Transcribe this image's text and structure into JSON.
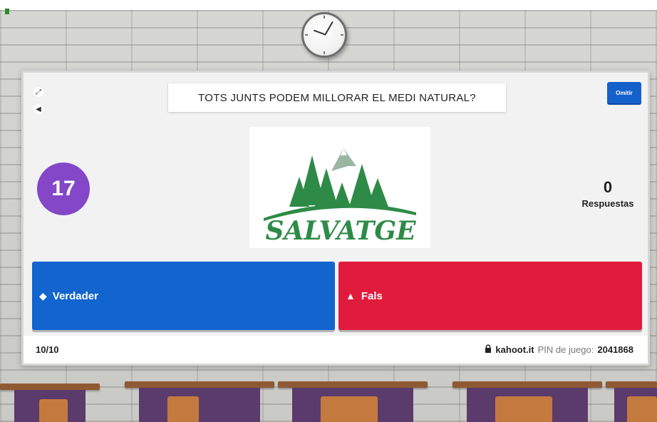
{
  "question": {
    "text": "TOTS JUNTS PODEM MILLORAR EL MEDI NATURAL?"
  },
  "controls": {
    "skip_label": "Omitir",
    "icons": [
      "expand-icon",
      "sound-icon"
    ]
  },
  "timer": {
    "seconds": "17",
    "color": "#8447c7"
  },
  "image": {
    "logo_text": "SALVATGE",
    "logo_color": "#2e8b47"
  },
  "answers_count": {
    "value": "0",
    "label": "Respuestas"
  },
  "answers": [
    {
      "label": "Verdader",
      "shape": "diamond",
      "color": "#1264cf"
    },
    {
      "label": "Fals",
      "shape": "triangle",
      "color": "#e01b3c"
    }
  ],
  "footer": {
    "progress": "10/10",
    "site": "kahoot.it",
    "pin_label": "PIN de juego:",
    "pin_code": "2041868"
  }
}
